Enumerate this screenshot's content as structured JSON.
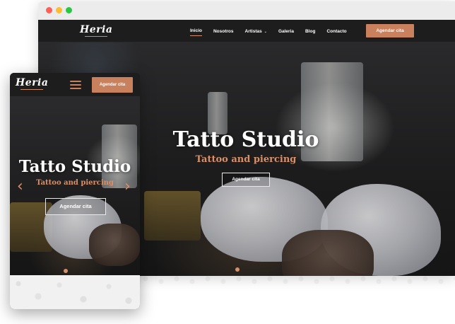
{
  "colors": {
    "accent": "#c9805d",
    "subtitle": "#d8906a",
    "nav_bg": "#1d1d1d",
    "traffic_red": "#ff5f57",
    "traffic_yellow": "#febc2e",
    "traffic_green": "#28c840"
  },
  "icons": {
    "browser_dots": [
      "close-dot",
      "minimize-dot",
      "maximize-dot"
    ],
    "menu": "hamburger-icon",
    "carousel_prev": "chevron-left-icon",
    "carousel_next": "chevron-right-icon",
    "dropdown": "chevron-down-icon"
  },
  "desktop": {
    "logo": "Heria",
    "nav": {
      "items": [
        {
          "label": "Inicio"
        },
        {
          "label": "Nosotros"
        },
        {
          "label": "Artistas"
        },
        {
          "label": "Galeria"
        },
        {
          "label": "Blog"
        },
        {
          "label": "Contacto"
        }
      ],
      "chevron": "⌄",
      "cta": "Agendar cita"
    },
    "hero": {
      "title": "Tatto Studio",
      "subtitle": "Tattoo and piercing",
      "button": "Agendar cita"
    }
  },
  "mobile": {
    "logo": "Heria",
    "cta": "Agendar cita",
    "hero": {
      "title": "Tatto Studio",
      "subtitle": "Tattoo and piercing",
      "button": "Agendar cita",
      "prev_arrow": "‹",
      "next_arrow": "›"
    }
  }
}
